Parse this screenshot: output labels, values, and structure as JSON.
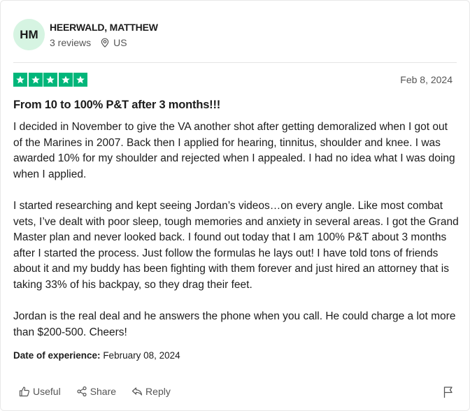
{
  "reviewer": {
    "initials": "HM",
    "name": "HEERWALD, MATTHEW",
    "reviews_count": "3 reviews",
    "country": "US",
    "avatar_color": "#d6f4e2"
  },
  "review": {
    "rating": 5,
    "max_rating": 5,
    "star_color": "#00b67a",
    "date": "Feb 8, 2024",
    "title": "From 10 to 100% P&T after 3 months!!!",
    "paragraphs": [
      "I decided in November to give the VA another shot after getting demoralized when I got out of the Marines in 2007. Back then I applied for hearing, tinnitus, shoulder and knee. I was awarded 10% for my shoulder and rejected when I appealed. I had no idea what I was doing when I applied.",
      "I started researching and kept seeing Jordan’s videos…on every angle. Like most combat vets, I’ve dealt with poor sleep, tough memories and anxiety in several areas. I got the Grand Master plan and never looked back. I found out today that I am 100% P&T about 3 months after I started the process. Just follow the formulas he lays out! I have told tons of friends about it and my buddy has been fighting with them forever and just hired an attorney that is taking 33% of his backpay, so they drag their feet.",
      "Jordan is the real deal and he answers the phone when you call. He could charge a lot more than $200-500. Cheers!"
    ],
    "experience_label": "Date of experience:",
    "experience_date": "February 08, 2024"
  },
  "actions": {
    "useful_label": "Useful",
    "share_label": "Share",
    "reply_label": "Reply"
  },
  "icons": {
    "location": "location-pin-icon",
    "useful": "thumbs-up-icon",
    "share": "share-icon",
    "reply": "reply-icon",
    "flag": "flag-icon",
    "star": "star-icon"
  }
}
